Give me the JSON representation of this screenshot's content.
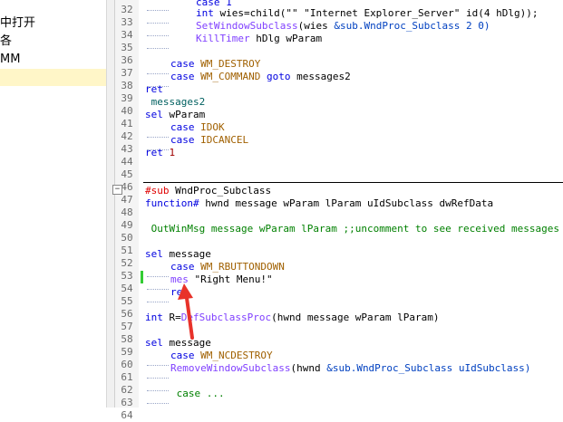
{
  "left_panel": {
    "items": [
      {
        "label": "中打开",
        "selected": false
      },
      {
        "label": "各",
        "selected": false
      },
      {
        "label": "MM",
        "selected": false
      },
      {
        "label": "",
        "selected": true
      }
    ]
  },
  "editor": {
    "line_numbers": [
      "32",
      "33",
      "34",
      "35",
      "36",
      "37",
      "38",
      "39",
      "40",
      "41",
      "42",
      "43",
      "44",
      "45",
      "46",
      "47",
      "48",
      "49",
      "50",
      "51",
      "52",
      "53",
      "54",
      "55",
      "56",
      "57",
      "58",
      "59",
      "60",
      "61",
      "62",
      "63",
      "64"
    ],
    "lines": {
      "l32a": "case 1",
      "l33a": "int ",
      "l33b": "wies=child(\"\" \"Internet Explorer_Server\" id(4 hDlg));",
      "l34a": "SetWindowSubclass",
      "l34b": "(wies ",
      "l34c": "&sub.WndProc_Subclass 2 0)",
      "l35a": "KillTimer",
      "l35b": " hDlg wParam",
      "l37a": "case ",
      "l37b": "WM_DESTROY",
      "l38a": "case ",
      "l38b": "WM_COMMAND ",
      "l38c": "goto ",
      "l38d": "messages2",
      "l39": "ret",
      "l40": " messages2",
      "l41a": "sel ",
      "l41b": "wParam",
      "l42a": "case ",
      "l42b": "IDOK",
      "l43a": "case ",
      "l43b": "IDCANCEL",
      "l44a": "ret ",
      "l44b": "1",
      "l47a": "#sub",
      "l47b": " WndProc_Subclass",
      "l48a": "function#",
      "l48b": " hwnd message wParam lParam uIdSubclass dwRefData",
      "l50": " OutWinMsg message wParam lParam ;;uncomment to see received messages",
      "l52a": "sel ",
      "l52b": "message",
      "l53a": "case ",
      "l53b": "WM_RBUTTONDOWN",
      "l54a": "mes",
      "l54b": " \"Right Menu!\"",
      "l55": "ret",
      "l57a": "int ",
      "l57b": "R=",
      "l57c": "DefSubclassProc",
      "l57d": "(hwnd message wParam lParam)",
      "l59a": "sel ",
      "l59b": "message",
      "l60a": "case ",
      "l60b": "WM_NCDESTROY",
      "l61a": "RemoveWindowSubclass",
      "l61b": "(hwnd ",
      "l61c": "&sub.WndProc_Subclass uIdSubclass)",
      "l63": " case ..."
    }
  },
  "annotation": {
    "color": "#e8322a"
  }
}
